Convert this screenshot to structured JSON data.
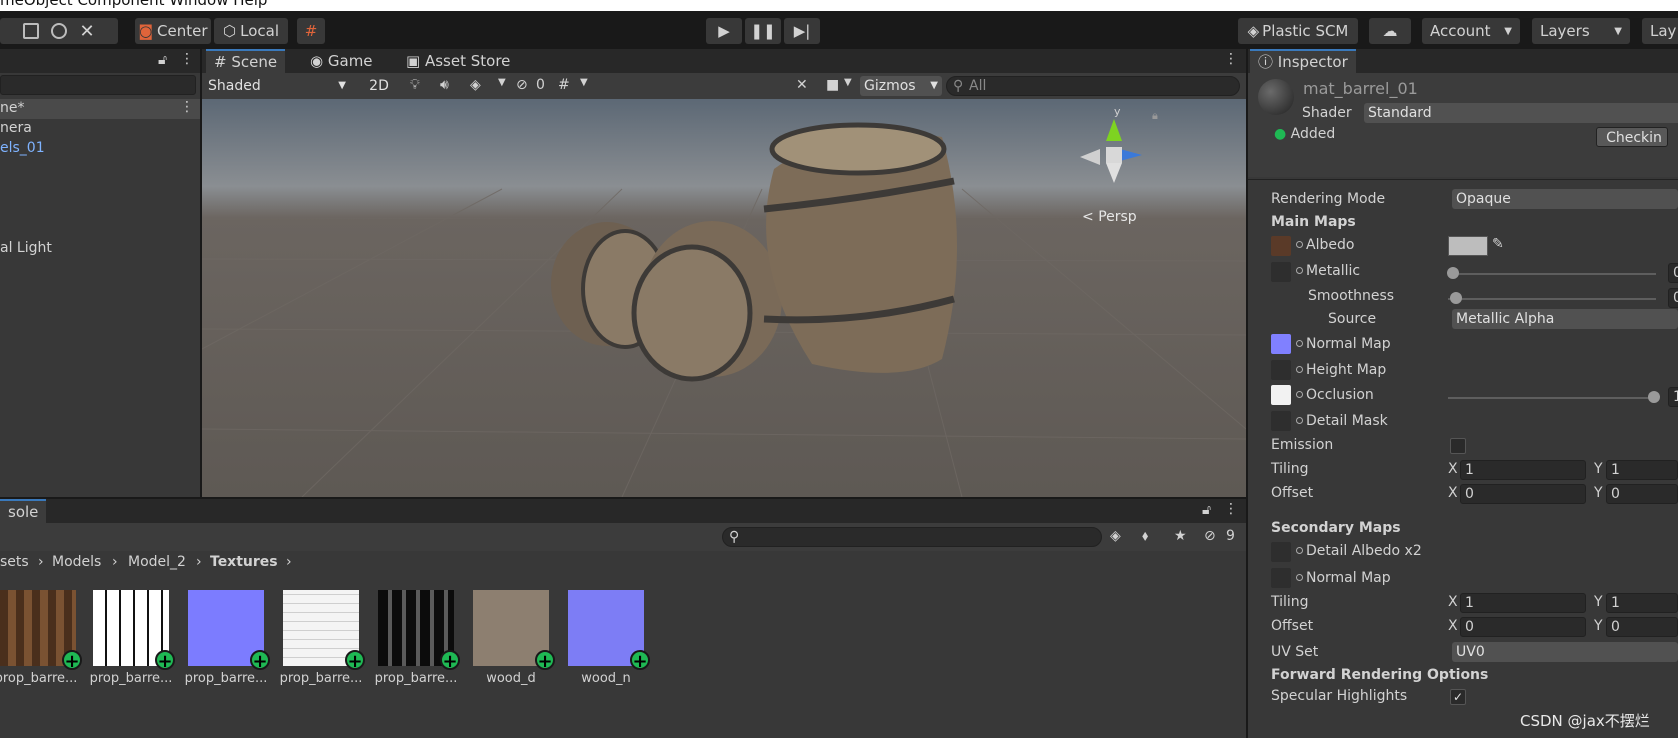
{
  "menubar": {
    "text": "meObject  Component  Window  Help"
  },
  "toolbar": {
    "center_label": "Center",
    "local_label": "Local",
    "plastic_label": "Plastic SCM",
    "account_label": "Account",
    "layers_label": "Layers",
    "layout_label": "Lay"
  },
  "hierarchy": {
    "scene_name": "ne*",
    "items": [
      "nera",
      "els_01",
      "al Light"
    ]
  },
  "scene_view": {
    "tabs": [
      "Scene",
      "Game",
      "Asset Store"
    ],
    "shading_mode": "Shaded",
    "mode_2d": "2D",
    "hidden_count": "0",
    "gizmos_label": "Gizmos",
    "search_placeholder": "All",
    "persp_label": "Persp",
    "axis_y": "y"
  },
  "project": {
    "tab_label": "sole",
    "breadcrumb": [
      "sets",
      "Models",
      "Model_2",
      "Textures"
    ],
    "hidden_count": "9",
    "assets": [
      "prop_barre...",
      "prop_barre...",
      "prop_barre...",
      "prop_barre...",
      "prop_barre...",
      "wood_d",
      "wood_n"
    ]
  },
  "inspector": {
    "tab_label": "Inspector",
    "material_name": "mat_barrel_01",
    "shader_label": "Shader",
    "shader_value": "Standard",
    "added_label": "Added",
    "checkin_label": "Checkin",
    "rendering_mode_label": "Rendering Mode",
    "rendering_mode_value": "Opaque",
    "main_maps_label": "Main Maps",
    "albedo_label": "Albedo",
    "metallic_label": "Metallic",
    "metallic_value": "0",
    "smoothness_label": "Smoothness",
    "smoothness_value": "0",
    "source_label": "Source",
    "source_value": "Metallic Alpha",
    "normal_map_label": "Normal Map",
    "height_map_label": "Height Map",
    "occlusion_label": "Occlusion",
    "occlusion_value": "1",
    "detail_mask_label": "Detail Mask",
    "emission_label": "Emission",
    "tiling_label": "Tiling",
    "offset_label": "Offset",
    "x_label": "X",
    "y_label": "Y",
    "main_tiling_x": "1",
    "main_tiling_y": "1",
    "main_offset_x": "0",
    "main_offset_y": "0",
    "secondary_maps_label": "Secondary Maps",
    "detail_albedo_label": "Detail Albedo x2",
    "sec_normal_map_label": "Normal Map",
    "sec_tiling_x": "1",
    "sec_tiling_y": "1",
    "sec_offset_x": "0",
    "sec_offset_y": "0",
    "uv_set_label": "UV Set",
    "uv_set_value": "UV0",
    "forward_label": "Forward Rendering Options",
    "specular_label": "Specular Highlights"
  },
  "watermark": "CSDN @jax不摆烂",
  "colors": {
    "accent": "#3a79bb",
    "add_badge": "#1fb954",
    "normal_map": "#8080ff"
  }
}
